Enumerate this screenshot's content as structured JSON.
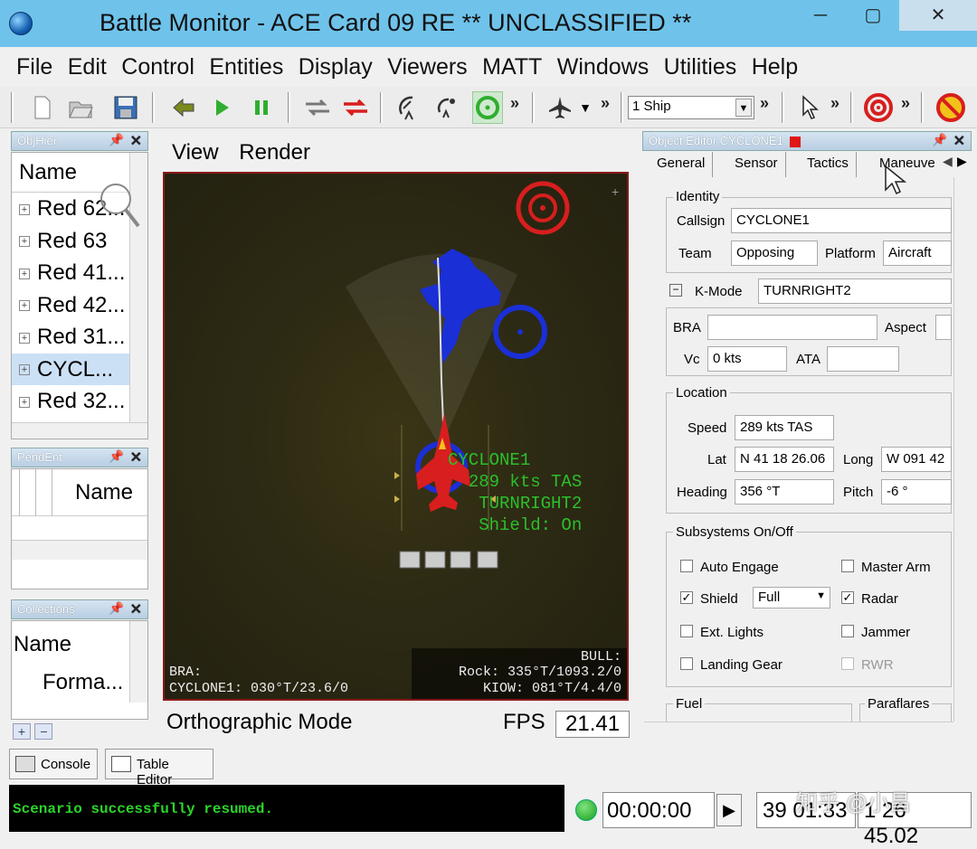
{
  "window": {
    "title": "Battle Monitor - ACE Card 09 RE   ** UNCLASSIFIED **",
    "min": "─",
    "max": "▢",
    "close": "✕"
  },
  "menu": [
    "File",
    "Edit",
    "Control",
    "Entities",
    "Display",
    "Viewers",
    "MATT",
    "Windows",
    "Utilities",
    "Help"
  ],
  "toolbar": {
    "ship_select": "1 Ship",
    "icons": [
      "new-icon",
      "open-icon",
      "save-icon",
      "back-icon",
      "play-icon",
      "pause-icon",
      "swap-icon",
      "swap-red-icon",
      "radar-dish-icon",
      "satellite-icon",
      "target-green-icon",
      "aircraft-icon",
      "pointer-icon",
      "target-red-icon",
      "no-fire-icon"
    ]
  },
  "objhier": {
    "title": "ObjHier",
    "header": "Name",
    "rows": [
      "Red 62...",
      "Red 63",
      "Red 41...",
      "Red 42...",
      "Red 31...",
      "CYCL...",
      "Red 32..."
    ],
    "selected_index": 5
  },
  "pendent": {
    "title": "PendEnt",
    "header": "Name"
  },
  "collections": {
    "title": "Collections",
    "header": "Name",
    "row": "Forma..."
  },
  "view": {
    "menu": [
      "View",
      "Render"
    ],
    "hud_callsign": "CYCLONE1",
    "hud_speed": "289 kts TAS",
    "hud_mode": "TURNRIGHT2",
    "hud_shield": "Shield: On",
    "bra_label": "BRA:",
    "bra_value": "CYCLONE1: 030°T/23.6/0",
    "bull_label": "BULL:",
    "bull_rock": "Rock: 335°T/1093.2/0",
    "bull_kiow": "KIOW: 081°T/4.4/0",
    "mode": "Orthographic Mode",
    "fps_label": "FPS",
    "fps_value": "21.41"
  },
  "object_editor": {
    "title": "Object Editor CYCLONE1",
    "tabs": [
      "General",
      "Sensor",
      "Tactics",
      "Maneuve"
    ],
    "identity_title": "Identity",
    "callsign_label": "Callsign",
    "callsign": "CYCLONE1",
    "team_label": "Team",
    "team": "Opposing",
    "platform_label": "Platform",
    "platform": "Aircraft",
    "kmode_label": "K-Mode",
    "kmode": "TURNRIGHT2",
    "bra_label": "BRA",
    "aspect_label": "Aspect",
    "vc_label": "Vc",
    "vc": "0 kts",
    "ata_label": "ATA",
    "location_title": "Location",
    "speed_label": "Speed",
    "speed": "289 kts TAS",
    "lat_label": "Lat",
    "lat": "N 41 18 26.06",
    "long_label": "Long",
    "long": "W 091 42",
    "heading_label": "Heading",
    "heading": "356 °T",
    "pitch_label": "Pitch",
    "pitch": "-6 °",
    "subsystems_title": "Subsystems On/Off",
    "auto_engage": "Auto Engage",
    "master_arm": "Master Arm",
    "shield": "Shield",
    "shield_level": "Full",
    "radar": "Radar",
    "ext_lights": "Ext. Lights",
    "jammer": "Jammer",
    "landing_gear": "Landing Gear",
    "rwr": "RWR",
    "fuel_title": "Fuel",
    "paraflares_title": "Paraflares"
  },
  "bottom": {
    "console_tab": "Console",
    "table_editor_tab": "Table Editor",
    "console_message": "Scenario successfully resumed.",
    "clock": "00:00:00",
    "lat": "39 01:33",
    "lon": "1 26 45.02",
    "watermark": "知乎 @小昌"
  },
  "colors": {
    "titlebar": "#6fc3ea",
    "blue_force": "#1a2fd6",
    "red_force": "#d81e1e",
    "hud_green": "#2bbf2b"
  }
}
